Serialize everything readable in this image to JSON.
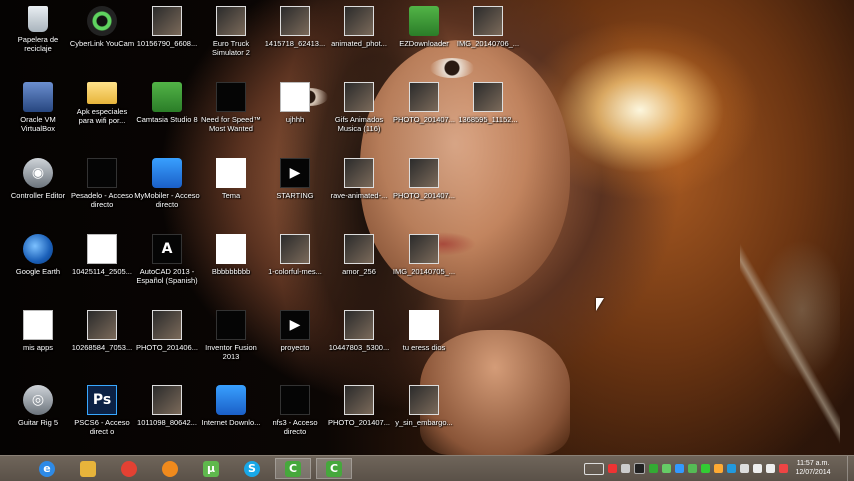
{
  "desktop": {
    "icons": [
      {
        "label": "Papelera de reciclaje",
        "icon": "recycle-bin-icon"
      },
      {
        "label": "CyberLink YouCam",
        "icon": "webcam-icon"
      },
      {
        "label": "10156790_6608...",
        "icon": "image-file-icon"
      },
      {
        "label": "Euro Truck Simulator 2",
        "icon": "truck-icon"
      },
      {
        "label": "1415718_62413...",
        "icon": "image-file-icon"
      },
      {
        "label": "animated_phot...",
        "icon": "image-file-icon"
      },
      {
        "label": "EZDownloader",
        "icon": "downloader-icon"
      },
      {
        "label": "IMG_20140706_...",
        "icon": "image-file-icon"
      },
      {
        "label": "Oracle VM VirtualBox",
        "icon": "virtualbox-icon"
      },
      {
        "label": "Apk especiales para wifi por...",
        "icon": "folder-icon"
      },
      {
        "label": "Camtasia Studio 8",
        "icon": "camtasia-icon"
      },
      {
        "label": "Need for Speed™ Most Wanted",
        "icon": "game-icon"
      },
      {
        "label": "ujhhh",
        "icon": "blank-file-icon"
      },
      {
        "label": "Gifs Animados Musica (116)",
        "icon": "image-file-icon"
      },
      {
        "label": "PHOTO_201407...",
        "icon": "image-file-icon"
      },
      {
        "label": "1368595_11152...",
        "icon": "image-file-icon"
      },
      {
        "label": "Controller Editor",
        "icon": "controller-icon"
      },
      {
        "label": "Pesadelo - Acceso directo",
        "icon": "shortcut-icon"
      },
      {
        "label": "MyMobiler - Acceso directo",
        "icon": "mobile-icon"
      },
      {
        "label": "Tema",
        "icon": "wav-file-icon"
      },
      {
        "label": "STARTING",
        "icon": "video-file-icon"
      },
      {
        "label": "rave-animated-...",
        "icon": "image-file-icon"
      },
      {
        "label": "PHOTO_201407...",
        "icon": "image-file-icon"
      },
      {
        "label": "Google Earth",
        "icon": "earth-icon"
      },
      {
        "label": "10425114_2505...",
        "icon": "document-icon"
      },
      {
        "label": "AutoCAD 2013 - Español (Spanish)",
        "icon": "autocad-icon"
      },
      {
        "label": "Bbbbbbbbb",
        "icon": "wav-file-icon"
      },
      {
        "label": "1-colorful-mes...",
        "icon": "image-file-icon"
      },
      {
        "label": "amor_256",
        "icon": "image-file-icon"
      },
      {
        "label": "IMG_20140705_...",
        "icon": "image-file-icon"
      },
      {
        "label": "mis apps",
        "icon": "blank-file-icon"
      },
      {
        "label": "10268584_7053...",
        "icon": "image-file-icon"
      },
      {
        "label": "PHOTO_201406...",
        "icon": "image-file-icon"
      },
      {
        "label": "Inventor Fusion 2013",
        "icon": "inventor-icon"
      },
      {
        "label": "proyecto",
        "icon": "video-file-icon"
      },
      {
        "label": "10447803_5300...",
        "icon": "image-file-icon"
      },
      {
        "label": "tu eress  dios",
        "icon": "wav-file-icon"
      },
      {
        "label": "Guitar Rig 5",
        "icon": "guitar-rig-icon"
      },
      {
        "label": "PSCS6 - Acceso direct o",
        "icon": "photoshop-icon"
      },
      {
        "label": "1011098_80642...",
        "icon": "image-file-icon"
      },
      {
        "label": "Internet Downlo...",
        "icon": "idm-icon"
      },
      {
        "label": "nfs3 - Acceso directo",
        "icon": "game-icon"
      },
      {
        "label": "PHOTO_201407...",
        "icon": "image-file-icon"
      },
      {
        "label": "y_sin_embargo...",
        "icon": "image-file-icon"
      }
    ]
  },
  "taskbar": {
    "pinned": [
      {
        "name": "internet-explorer",
        "glyph": "e",
        "color": "#2e8ae6"
      },
      {
        "name": "file-explorer",
        "glyph": "",
        "color": "#e7b43b"
      },
      {
        "name": "chrome",
        "glyph": "",
        "color": "#e34133"
      },
      {
        "name": "firefox",
        "glyph": "",
        "color": "#f08a1d"
      },
      {
        "name": "utorrent",
        "glyph": "µ",
        "color": "#5fb84d"
      },
      {
        "name": "skype",
        "glyph": "S",
        "color": "#18a8e8"
      },
      {
        "name": "camtasia",
        "glyph": "C",
        "color": "#46a83c"
      },
      {
        "name": "camtasia-recorder",
        "glyph": "C",
        "color": "#46a83c"
      }
    ],
    "clock": {
      "time": "11:57 a.m.",
      "date": "12/07/2014"
    }
  }
}
